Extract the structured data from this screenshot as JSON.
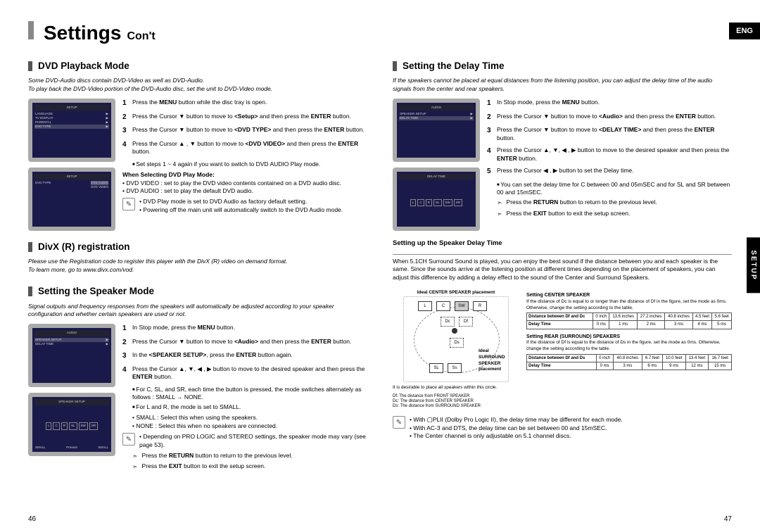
{
  "header": {
    "title": "Settings",
    "subtitle": "Con't",
    "lang_badge": "ENG",
    "side_tab": "SETUP"
  },
  "menu_words": {
    "menu": "MENU",
    "enter": "ENTER",
    "return": "RETURN",
    "exit": "EXIT"
  },
  "left": {
    "s1": {
      "heading": "DVD Playback Mode",
      "note": "Some DVD-Audio discs contain DVD-Video as well as DVD-Audio.\nTo play back the DVD-Video portion of the DVD-Audio disc, set the unit to DVD-Video mode.",
      "steps": [
        "Press the <b>MENU</b> button while the disc tray is open.",
        "Press the Cursor ▼ button to move to <b>&lt;Setup&gt;</b> and then press the <b>ENTER</b> button.",
        "Press the Cursor ▼ button to move to <b>&lt;DVD TYPE&gt;</b> and then press the <b>ENTER</b> button.",
        "Press the Cursor ▲ , ▼ button to move to <b>&lt;DVD VIDEO&gt;</b> and then press the <b>ENTER</b> button."
      ],
      "sub4": "Set steps 1 ~ 4 again if you want to switch to DVD AUDIO Play mode.",
      "when_title": "When Selecting DVD Play Mode:",
      "when_lines": [
        "DVD VIDEO : set to play the DVD video contents contained on a DVD audio disc.",
        "DVD AUDIO : set to play the default DVD audio."
      ],
      "tip_lines": [
        "DVD Play mode is set to DVD Audio as factory default setting.",
        "Powering off the main unit will automatically switch to the DVD Audio mode."
      ]
    },
    "s2": {
      "heading": "DivX (R) registration",
      "note": "Please use the Registration code to register this player with the DivX (R) video on demand format.\nTo learn more, go to www.divx.com/vod."
    },
    "s3": {
      "heading": "Setting the Speaker Mode",
      "note": "Signal outputs and frequency responses from the speakers will automatically be adjusted according to your speaker configuration and whether certain speakers are used or not.",
      "steps": [
        "In Stop mode, press the <b>MENU</b> button.",
        "Press the Cursor ▼ button to move to <b>&lt;Audio&gt;</b> and then press the <b>ENTER</b> button.",
        "In the <b>&lt;SPEAKER SETUP&gt;</b>, press the <b>ENTER</b> button again.",
        "Press the Cursor ▲, ▼, ◀ , ▶ button to move to the desired speaker and then press the <b>ENTER</b> button."
      ],
      "subA": "For C, SL, and SR, each time the button is pressed, the mode switches alternately as follows : SMALL → NONE.",
      "subB": "For L and R, the mode is set to SMALL.",
      "defs": [
        "SMALL : Select this when using the speakers.",
        "NONE : Select this when no speakers are connected."
      ],
      "tip": "Depending on PRO LOGIC and STEREO settings, the speaker mode may vary (see page 53).",
      "arrow1": "Press the <b>RETURN</b> button to return to the previous level.",
      "arrow2": "Press the <b>EXIT</b> button to exit the setup screen."
    }
  },
  "right": {
    "s1": {
      "heading": "Setting the Delay Time",
      "note": "If the speakers cannot be placed at equal distances from the listening position, you can adjust the delay time of the audio signals from the center and rear speakers.",
      "steps": [
        "In Stop mode, press the <b>MENU</b> button.",
        "Press the Cursor ▼ button to move to <b>&lt;Audio&gt;</b> and then press the <b>ENTER</b> button.",
        "Press the Cursor ▼ button to move to <b>&lt;DELAY TIME&gt;</b> and then press the <b>ENTER</b> button.",
        "Press the Cursor ▲, ▼, ◀ , ▶ button to move to the desired speaker and then press the <b>ENTER</b> button.",
        "Press the Cursor ◀ , ▶ button to set the Delay time."
      ],
      "sub5": "You can set the delay time for C between 00 and 05mSEC and for SL and SR between 00 and 15mSEC.",
      "arrow1": "Press the <b>RETURN</b> button to return to the previous level.",
      "arrow2": "Press the <b>EXIT</b> button to exit the setup screen."
    },
    "s2": {
      "heading": "Setting up the Speaker Delay Time",
      "intro": "When 5.1CH Surround Sound is played, you can enjoy the best sound if the distance between you and each speaker is the same. Since the sounds arrive at the listening position at different times depending on the placement of speakers, you can adjust this difference by adding a delay effect to the sound of the Center and Surround Speakers.",
      "diagram": {
        "center_label": "Ideal CENTER SPEAKER placement",
        "surround_label": "Ideal SURROUND SPEAKER placement",
        "circle_note": "It is desirable to place all speakers within this circle.",
        "legend": [
          "Df: The distance from FRONT SPEAKER",
          "Dc: The distance from CENTER SPEAKER",
          "Ds: The distance from SURROUND SPEAKER"
        ]
      },
      "tbl_center": {
        "title": "Setting CENTER SPEAKER",
        "note": "If the distance of Dc is equal to or longer than the distance of Df in the figure, set the mode as 0ms. Otherwise, change the setting according to the table.",
        "row1_label": "Distance between Df and Dc",
        "row1_vals": [
          "0 inch",
          "13.6 inches",
          "27.2 inches",
          "40.8 inches",
          "4.5 feet",
          "5.6 feet"
        ],
        "row2_label": "Delay Time",
        "row2_vals": [
          "0 ms",
          "1 ms",
          "2 ms",
          "3 ms",
          "4 ms",
          "5 ms"
        ]
      },
      "tbl_rear": {
        "title": "Setting REAR (SURROUND) SPEAKERS",
        "note": "If the distance of Df is equal to the distance of Ds in the figure, set the mode as 0ms. Otherwise, change the setting according to the table.",
        "row1_label": "Distance between Df and Ds",
        "row1_vals": [
          "0 inch",
          "40.8 inches",
          "6.7 feet",
          "10.0 feet",
          "13.4 feet",
          "16.7 feet"
        ],
        "row2_label": "Delay Time",
        "row2_vals": [
          "0 ms",
          "3 ms",
          "6 ms",
          "9 ms",
          "12 ms",
          "15 ms"
        ]
      },
      "tip_lines": [
        "With ▢PLII (Dolby Pro Logic II), the delay time may be different for each mode.",
        "With AC-3 and DTS, the delay time can be set between 00 and 15mSEC.",
        "The Center channel is only adjustable on 5.1 channel discs."
      ]
    }
  },
  "page_numbers": {
    "left": "46",
    "right": "47"
  }
}
